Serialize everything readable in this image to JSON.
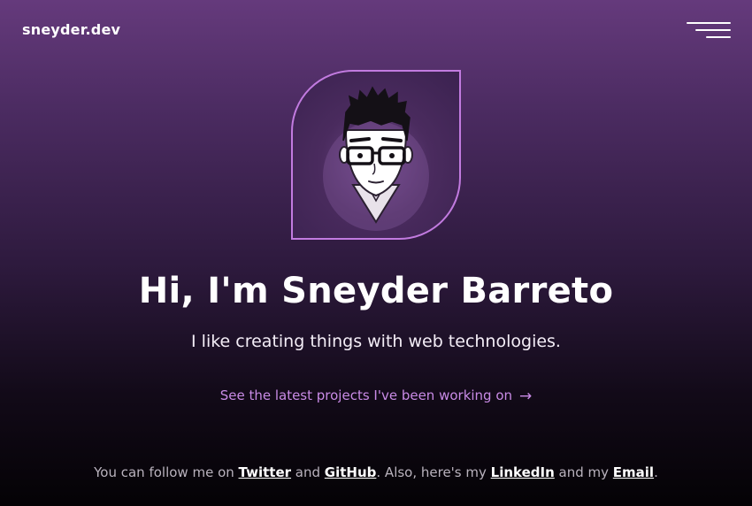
{
  "header": {
    "logo_text": "sneyder.dev",
    "menu_icon": "hamburger-menu-icon"
  },
  "avatar": {
    "description": "cartoon avatar",
    "accent_color": "#c27be0"
  },
  "hero": {
    "title": "Hi, I'm Sneyder Barreto",
    "subtitle": "I like creating things with web technologies.",
    "projects_link": "See the latest projects I've been working on",
    "arrow_icon": "→"
  },
  "social": {
    "prefix": "You can follow me on ",
    "twitter": "Twitter",
    "and1": " and ",
    "github": "GitHub",
    "middle": ". Also, here's my ",
    "linkedin": "LinkedIn",
    "and2": " and my ",
    "email": "Email",
    "suffix": "."
  },
  "colors": {
    "accent": "#c98be6",
    "background_top": "#653a7c",
    "background_bottom": "#040205"
  }
}
